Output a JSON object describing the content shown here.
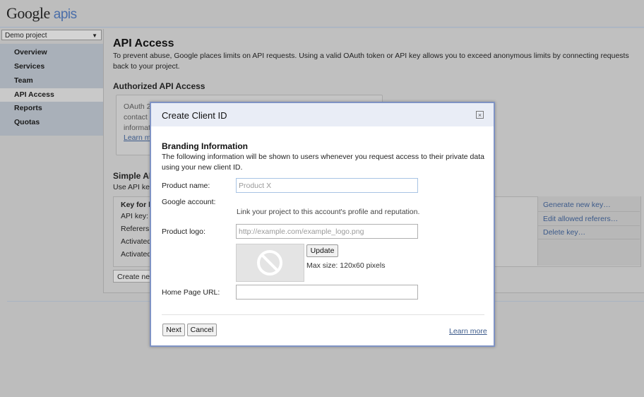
{
  "header": {
    "logo_google": "Google",
    "logo_apis": "apis"
  },
  "sidebar": {
    "project_select": "Demo project",
    "items": [
      {
        "label": "Overview"
      },
      {
        "label": "Services"
      },
      {
        "label": "Team"
      },
      {
        "label": "API Access"
      },
      {
        "label": "Reports"
      },
      {
        "label": "Quotas"
      }
    ]
  },
  "main": {
    "title": "API Access",
    "description": "To prevent abuse, Google places limits on API requests. Using a valid OAuth token or API key allows you to exceed anonymous limits by connecting requests back to your project.",
    "authorized_heading": "Authorized API Access",
    "oauth_lines": [
      "OAuth 2",
      "contact",
      "informat"
    ],
    "oauth_link": "Learn m",
    "simple_heading": "Simple AP",
    "simple_desc": "Use API ke",
    "key_rows": [
      "Key for b",
      "API key:",
      "Referers:",
      "Activated",
      "Activated"
    ],
    "key_actions": [
      "Generate new key…",
      "Edit allowed referers…",
      "Delete key…"
    ],
    "create_button": "Create ne"
  },
  "modal": {
    "title": "Create Client ID",
    "close_glyph": "×",
    "branding_heading": "Branding Information",
    "branding_desc": "The following information will be shown to users whenever you request access to their private data using your new client ID.",
    "product_name_label": "Product name:",
    "product_name_placeholder": "Product X",
    "google_account_label": "Google account:",
    "google_account_help": "Link your project to this account's profile and reputation.",
    "product_logo_label": "Product logo:",
    "product_logo_placeholder": "http://example.com/example_logo.png",
    "update_button": "Update",
    "max_size": "Max size: 120x60 pixels",
    "home_page_label": "Home Page URL:",
    "home_page_value": "",
    "next_button": "Next",
    "cancel_button": "Cancel",
    "learn_more": "Learn more"
  },
  "colors": {
    "link": "#3c5a8a",
    "modal_border": "#7f93c4",
    "overlay": "#bdbdbd"
  }
}
